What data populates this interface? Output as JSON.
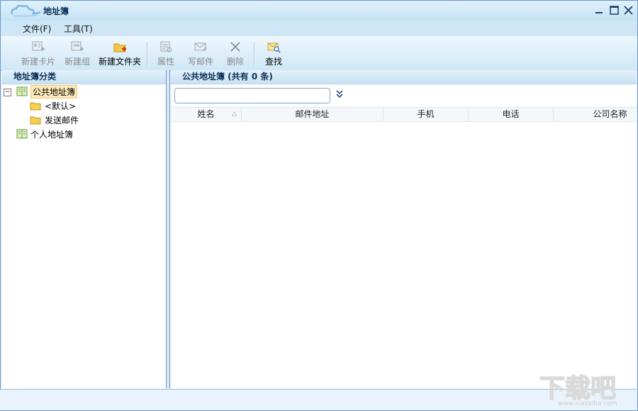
{
  "window": {
    "title": "地址簿"
  },
  "menu": {
    "file": "文件(F)",
    "tools": "工具(T)"
  },
  "toolbar": {
    "new_card": "新建卡片",
    "new_group": "新建组",
    "new_folder": "新建文件夹",
    "properties": "属性",
    "write_mail": "写邮件",
    "delete": "删除",
    "find": "查找"
  },
  "left_pane": {
    "header": "地址簿分类",
    "tree": {
      "public": "公共地址簿",
      "default": "<默认>",
      "sent": "发送邮件",
      "personal": "个人地址簿"
    }
  },
  "right_pane": {
    "header": "公共地址簿  (共有 0 条)",
    "search": {
      "value": "",
      "placeholder": ""
    },
    "columns": [
      "姓名",
      "邮件地址",
      "手机",
      "电话",
      "公司名称"
    ]
  },
  "watermark": {
    "text": "下载吧",
    "url_text": "www.xiazaiba.com"
  },
  "colors": {
    "accent": "#6e98c6",
    "header_bg": "#c9e2f4",
    "selection": "#fde9b8"
  }
}
